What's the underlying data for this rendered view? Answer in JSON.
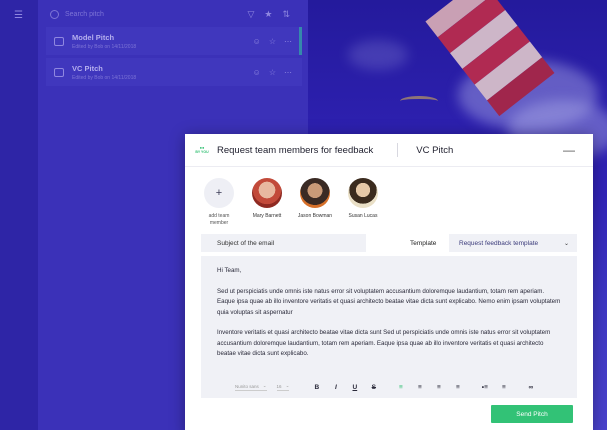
{
  "sidebar": {
    "menu_icon": "menu-icon"
  },
  "list": {
    "search_placeholder": "Search pitch",
    "pitches": [
      {
        "title": "Model Pitch",
        "subtitle": "Edited by Bob on 14/11/2018"
      },
      {
        "title": "VC Pitch",
        "subtitle": "Edited by Bob on 14/11/2018"
      }
    ]
  },
  "modal": {
    "logo_text": "BY YOU",
    "title": "Request team members for feedback",
    "pitch_name": "VC Pitch",
    "minimize_icon": "minus-icon",
    "add_member_label": "add team member",
    "members": [
      {
        "name": "Mary Barnett"
      },
      {
        "name": "Jason Bowman"
      },
      {
        "name": "Susan Lucas"
      }
    ],
    "subject_placeholder": "Subject of the email",
    "template_label": "Template",
    "template_value": "Request feedback template",
    "body_greeting": "Hi Team,",
    "body_p1": "Sed ut perspiciatis unde omnis iste natus error sit voluptatem accusantium doloremque laudantium, totam rem aperiam. Eaque ipsa quae ab illo inventore veritatis et quasi architecto beatae vitae dicta sunt explicabo. Nemo enim ipsam voluptatem quia voluptas sit aspernatur",
    "body_p2": "Inventore veritatis et quasi architecto beatae vitae dicta sunt Sed ut perspiciatis unde omnis iste natus error sit voluptatem accusantium doloremque laudantium, totam rem aperiam. Eaque ipsa quae ab illo inventore veritatis et quasi architecto beatae vitae dicta sunt explicabo.",
    "toolbar": {
      "font": "Nunito sans",
      "size": "16",
      "bold": "B",
      "italic": "I",
      "underline": "U",
      "strike": "S"
    },
    "send_label": "Send Pitch"
  },
  "colors": {
    "accent": "#32c276",
    "overlay": "#3a2fb4"
  }
}
